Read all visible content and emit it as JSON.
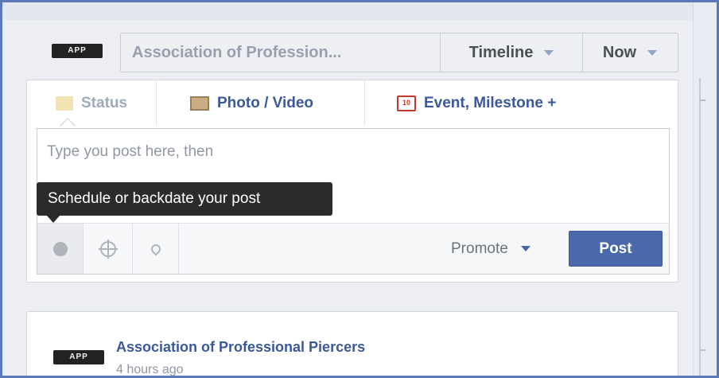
{
  "header": {
    "logo_text": "APP",
    "page_name": "Association of Profession...",
    "timeline_label": "Timeline",
    "now_label": "Now"
  },
  "composer": {
    "tabs": [
      {
        "label": "Status",
        "icon": "status-icon"
      },
      {
        "label": "Photo / Video",
        "icon": "photo-icon"
      },
      {
        "label": "Event, Milestone +",
        "icon": "calendar-icon",
        "icon_text": "10"
      }
    ],
    "placeholder": "Type you post here, then",
    "tooltip": "Schedule or backdate your post",
    "promote_label": "Promote",
    "post_label": "Post"
  },
  "feed": {
    "logo_text": "APP",
    "page_name": "Association of Professional Piercers",
    "time": "4 hours ago"
  },
  "colors": {
    "accent": "#3b5998",
    "button": "#4a69ad",
    "frame_border": "#5b78b8",
    "tooltip_bg": "#2b2b2b"
  }
}
